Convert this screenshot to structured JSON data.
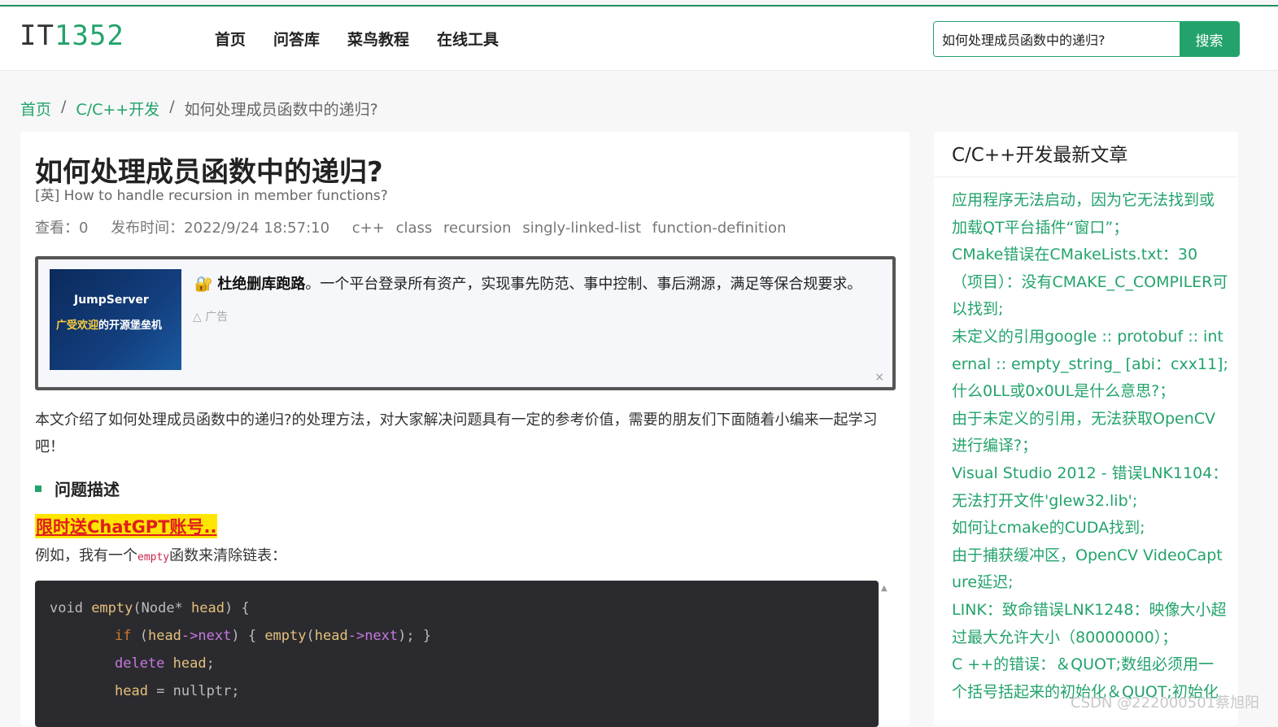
{
  "logo": {
    "part1": "IT",
    "part2": "1352"
  },
  "nav": [
    "首页",
    "问答库",
    "菜鸟教程",
    "在线工具"
  ],
  "search": {
    "value": "如何处理成员函数中的递归?",
    "button": "搜索"
  },
  "breadcrumb": {
    "home": "首页",
    "sep": "/",
    "category": "C/C++开发",
    "current": "如何处理成员函数中的递归?"
  },
  "article": {
    "title": "如何处理成员函数中的递归?",
    "en_title": "[英] How to handle recursion in member functions?",
    "views": "查看：0",
    "published": "发布时间：2022/9/24 18:57:10",
    "tags": [
      "c++",
      "class",
      "recursion",
      "singly-linked-list",
      "function-definition"
    ],
    "intro": "本文介绍了如何处理成员函数中的递归?的处理方法，对大家解决问题具有一定的参考价值，需要的朋友们下面随着小编来一起学习吧！",
    "section_title": "问题描述",
    "promo": "限时送ChatGPT账号..",
    "line_before": "例如，我有一个",
    "inline_code": "empty",
    "line_after": "函数来清除链表："
  },
  "ad": {
    "icon": "🔐",
    "brand": "JumpServer",
    "slogan_highlight": "广受欢迎",
    "slogan_rest": "的开源堡垒机",
    "bold": "杜绝删库跑路",
    "text": "。一个平台登录所有资产，实现事先防范、事中控制、事后溯源，满足等保合规要求。",
    "label": "广告",
    "close": "×"
  },
  "code": {
    "l1": [
      "void ",
      "empty",
      "(Node* ",
      "head",
      ") {"
    ],
    "l2": [
      "if",
      " (",
      "head",
      "->",
      "next",
      ") { ",
      "empty",
      "(",
      "head",
      "->",
      "next",
      "); }"
    ],
    "l3": [
      "delete",
      " ",
      "head",
      ";"
    ],
    "l4": [
      "head",
      " = nullptr;"
    ]
  },
  "sidebar": {
    "title": "C/C++开发最新文章",
    "items": [
      "应用程序无法启动，因为它无法找到或加载QT平台插件“窗口”；",
      "CMake错误在CMakeLists.txt：30（项目）：没有CMAKE_C_COMPILER可以找到;",
      "未定义的引用google :: protobuf :: internal :: empty_string_ [abi：cxx11];",
      "什么0LL或0x0UL是什么意思?；",
      "由于未定义的引用，无法获取OpenCV进行编译?；",
      "Visual Studio 2012 - 错误LNK1104：无法打开文件'glew32.lib';",
      "如何让cmake的CUDA找到;",
      "由于捕获缓冲区，OpenCV VideoCapture延迟;",
      "LINK：致命错误LNK1248：映像大小超过最大允许大小（80000000）；",
      "C ++的错误：＆QUOT;数组必须用一个括号括起来的初始化＆QUOT;初始化"
    ]
  },
  "watermark": "CSDN @222000501蔡旭阳"
}
